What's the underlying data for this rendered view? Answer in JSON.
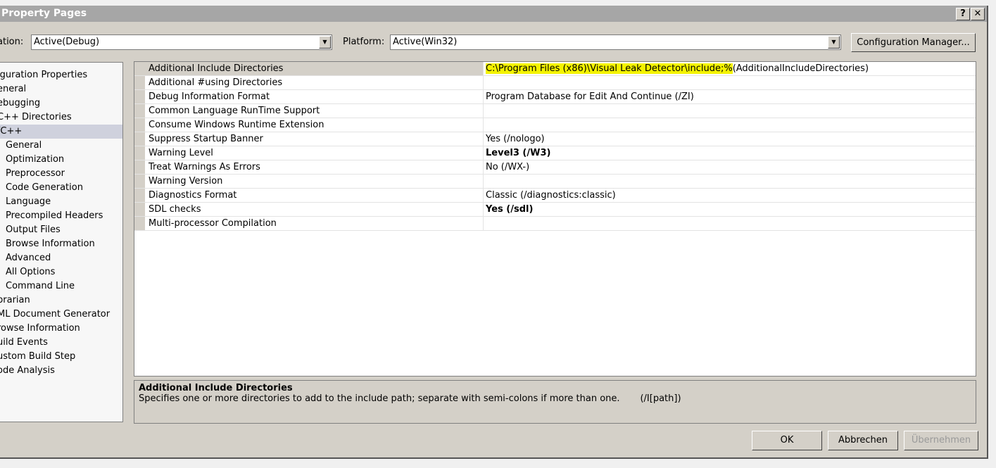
{
  "window": {
    "title": "Property Pages",
    "help": "?",
    "close": "✕"
  },
  "config": {
    "label": "ation:",
    "value": "Active(Debug)"
  },
  "platform": {
    "label": "Platform:",
    "value": "Active(Win32)"
  },
  "config_manager": "Configuration Manager...",
  "tree": [
    {
      "label": "iguration Properties",
      "indent": 0
    },
    {
      "label": "eneral",
      "indent": 0
    },
    {
      "label": "ebugging",
      "indent": 0
    },
    {
      "label": "C++ Directories",
      "indent": 0
    },
    {
      "label": "/C++",
      "indent": 0,
      "selected": true
    },
    {
      "label": "General",
      "indent": 1
    },
    {
      "label": "Optimization",
      "indent": 1
    },
    {
      "label": "Preprocessor",
      "indent": 1
    },
    {
      "label": "Code Generation",
      "indent": 1
    },
    {
      "label": "Language",
      "indent": 1
    },
    {
      "label": "Precompiled Headers",
      "indent": 1
    },
    {
      "label": "Output Files",
      "indent": 1
    },
    {
      "label": "Browse Information",
      "indent": 1
    },
    {
      "label": "Advanced",
      "indent": 1
    },
    {
      "label": "All Options",
      "indent": 1
    },
    {
      "label": "Command Line",
      "indent": 1
    },
    {
      "label": "brarian",
      "indent": 0
    },
    {
      "label": "ML Document Generator",
      "indent": 0
    },
    {
      "label": "rowse Information",
      "indent": 0
    },
    {
      "label": "uild Events",
      "indent": 0
    },
    {
      "label": "ustom Build Step",
      "indent": 0
    },
    {
      "label": "ode Analysis",
      "indent": 0
    }
  ],
  "properties": [
    {
      "name": "Additional Include Directories",
      "value_highlight": "C:\\Program Files (x86)\\Visual Leak Detector\\include;%",
      "value": "(AdditionalIncludeDirectories)",
      "selected": true
    },
    {
      "name": "Additional #using Directories",
      "value": ""
    },
    {
      "name": "Debug Information Format",
      "value": "Program Database for Edit And Continue (/ZI)"
    },
    {
      "name": "Common Language RunTime Support",
      "value": ""
    },
    {
      "name": "Consume Windows Runtime Extension",
      "value": ""
    },
    {
      "name": "Suppress Startup Banner",
      "value": "Yes (/nologo)"
    },
    {
      "name": "Warning Level",
      "value": "Level3 (/W3)",
      "bold": true
    },
    {
      "name": "Treat Warnings As Errors",
      "value": "No (/WX-)"
    },
    {
      "name": "Warning Version",
      "value": ""
    },
    {
      "name": "Diagnostics Format",
      "value": "Classic (/diagnostics:classic)"
    },
    {
      "name": "SDL checks",
      "value": "Yes (/sdl)",
      "bold": true
    },
    {
      "name": "Multi-processor Compilation",
      "value": ""
    }
  ],
  "description": {
    "title": "Additional Include Directories",
    "text": "Specifies one or more directories to add to the include path; separate with semi-colons if more than one.",
    "switch": "(/I[path])"
  },
  "buttons": {
    "ok": "OK",
    "cancel": "Abbrechen",
    "apply": "Übernehmen"
  },
  "highlight_color": "#f4f300"
}
